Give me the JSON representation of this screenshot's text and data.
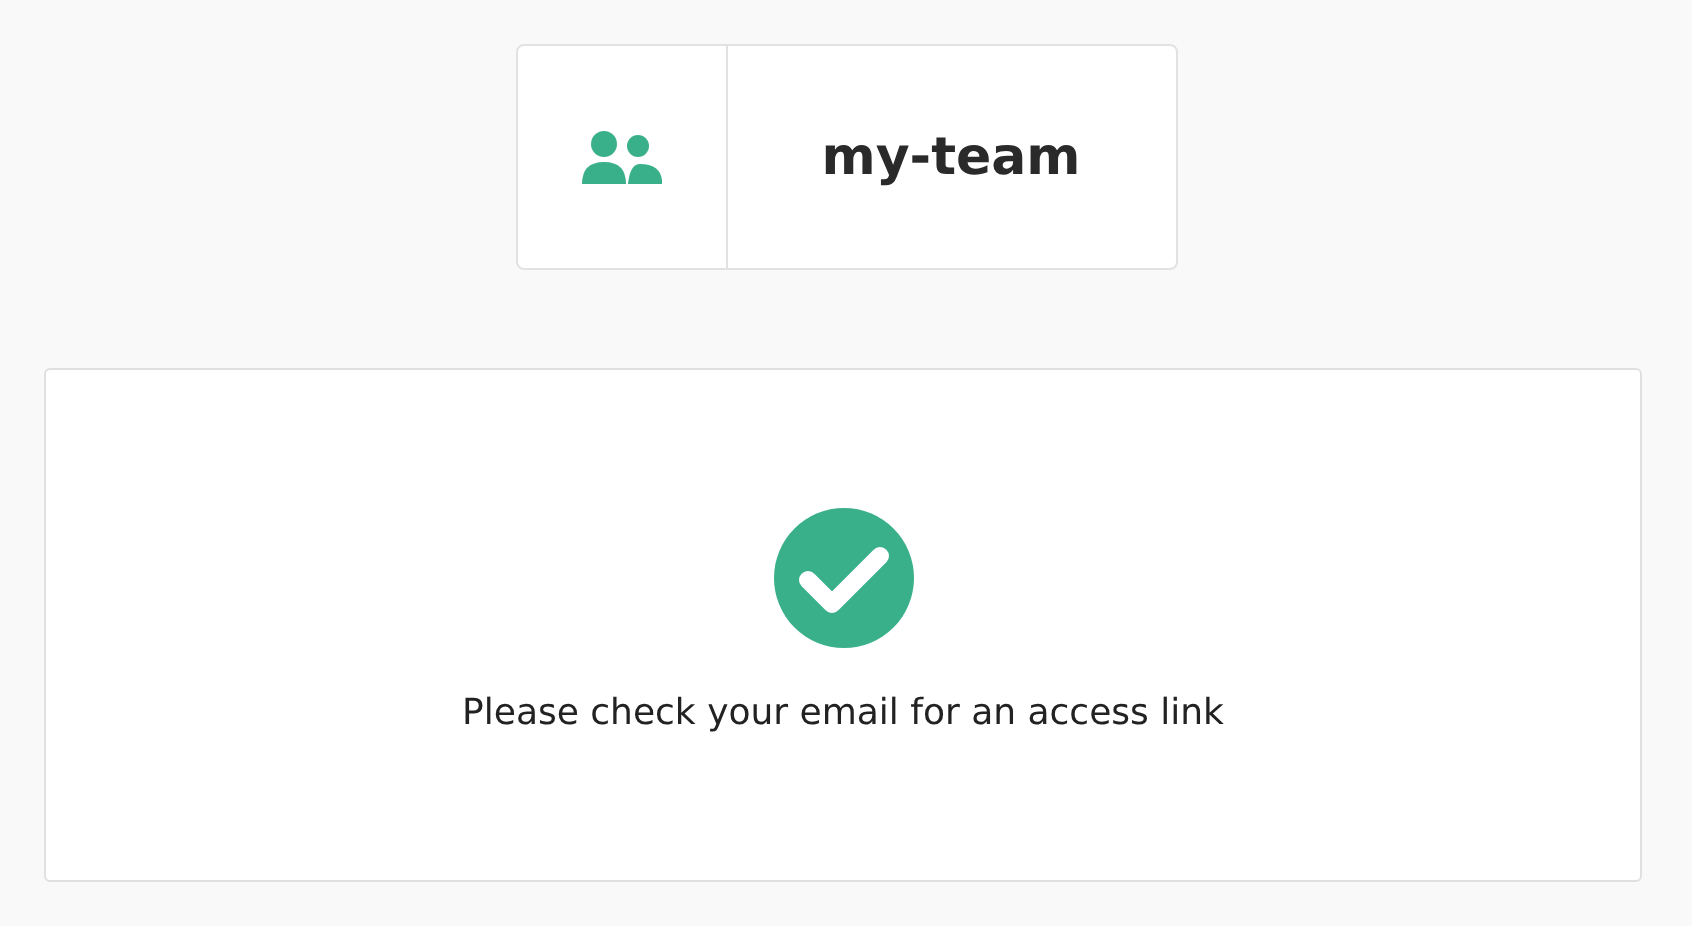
{
  "team": {
    "name": "my-team"
  },
  "message": {
    "text": "Please check your email for an access link"
  }
}
